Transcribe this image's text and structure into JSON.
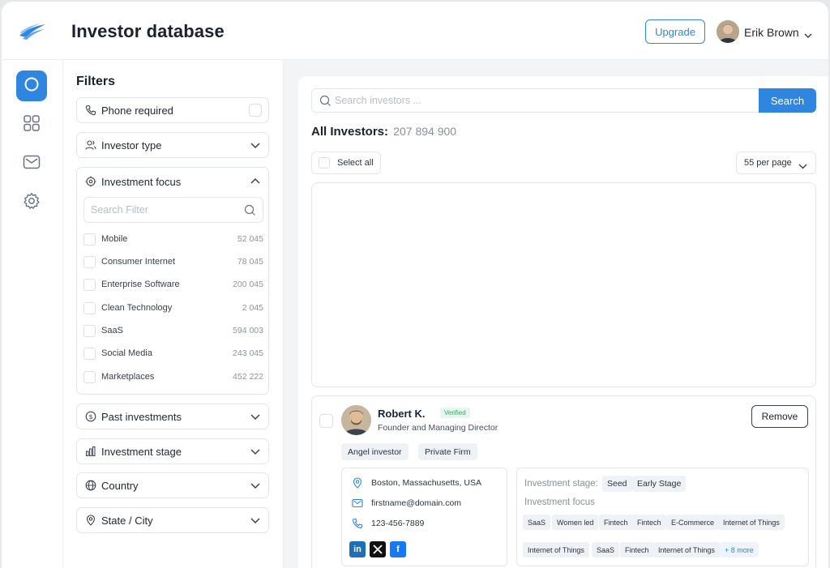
{
  "header": {
    "title": "Investor database",
    "upgrade_label": "Upgrade",
    "user_name": "Erik Brown"
  },
  "nav": {
    "items": [
      {
        "name": "search",
        "active": true
      },
      {
        "name": "dashboard",
        "active": false
      },
      {
        "name": "messages",
        "active": false
      },
      {
        "name": "settings",
        "active": false
      }
    ]
  },
  "filters": {
    "title": "Filters",
    "phone_required": "Phone required",
    "investor_type": "Investor type",
    "investment_focus": {
      "label": "Investment focus",
      "search_placeholder": "Search Filter",
      "options": [
        {
          "name": "Mobile",
          "count": "52 045"
        },
        {
          "name": "Consumer Internet",
          "count": "78 045"
        },
        {
          "name": "Enterprise Software",
          "count": "200 045"
        },
        {
          "name": "Clean Technology",
          "count": "2 045"
        },
        {
          "name": "SaaS",
          "count": "594 003"
        },
        {
          "name": "Social Media",
          "count": "243 045"
        },
        {
          "name": "Marketplaces",
          "count": "452 222"
        }
      ]
    },
    "past_investments": "Past investments",
    "investment_stage": "Investment stage",
    "country": "Country",
    "state_city": "State / City"
  },
  "main": {
    "search_placeholder": "Search investors ...",
    "search_button": "Search",
    "all_investors_label": "All Investors:",
    "all_investors_count": "207 894 900",
    "select_all": "Select all",
    "per_page": "55 per page"
  },
  "investor": {
    "name": "Robert K.",
    "verified": "Verified",
    "title": "Founder and Managing Director",
    "tags": [
      "Angel investor",
      "Private Firm"
    ],
    "location": "Boston, Massachusetts, USA",
    "email": "firstname@domain.com",
    "phone": "123-456-7889",
    "remove_label": "Remove",
    "stage_label": "Investment stage:",
    "stages": [
      "Seed",
      "Early Stage"
    ],
    "focus_label": "Investment focus",
    "focus_tags": [
      "SaaS",
      "Women led",
      "Fintech",
      "Fintech",
      "E-Commerce",
      "Internet of Things",
      "Internet of Things",
      "SaaS",
      "Fintech",
      "Internet of Things"
    ],
    "more_label": "+ 8 more",
    "socials": [
      "linkedin-icon",
      "x-icon",
      "facebook-icon"
    ]
  },
  "colors": {
    "accent": "#2f86e0",
    "verified": "#2fa869"
  }
}
